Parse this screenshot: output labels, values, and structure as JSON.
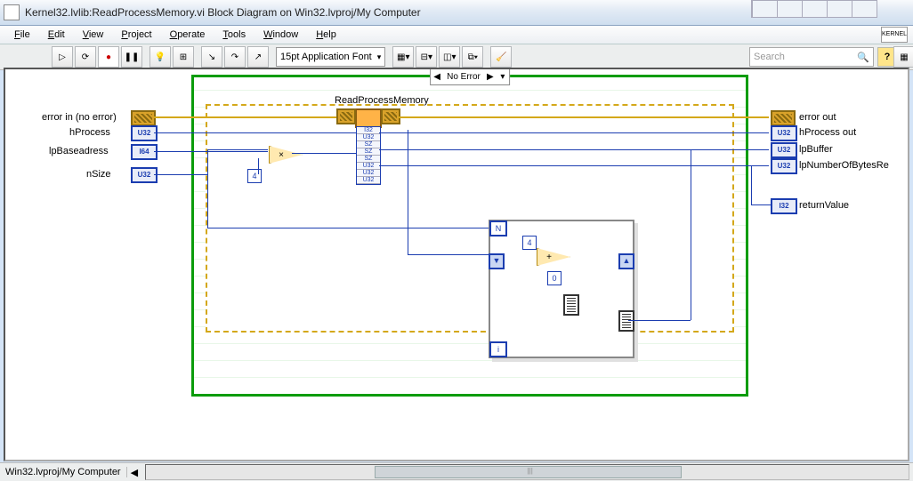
{
  "window": {
    "title": "Kernel32.lvlib:ReadProcessMemory.vi Block Diagram on Win32.lvproj/My Computer"
  },
  "menu": {
    "file": "File",
    "edit": "Edit",
    "view": "View",
    "project": "Project",
    "operate": "Operate",
    "tools": "Tools",
    "window": "Window",
    "help": "Help",
    "logo": "KERNEL"
  },
  "toolbar": {
    "font": "15pt Application Font",
    "search_placeholder": "Search",
    "help": "?"
  },
  "case": {
    "left": "◀",
    "label": "No Error",
    "right": "▶",
    "drop": "▾"
  },
  "inputs": {
    "error_in": "error in (no error)",
    "hProcess": "hProcess",
    "lpBaseaddress": "lpBaseadress",
    "nSize": "nSize"
  },
  "outputs": {
    "error_out": "error out",
    "hProcess_out": "hProcess out",
    "lpBuffer": "lpBuffer",
    "lpNumberOfBytesRe": "lpNumberOfBytesRe",
    "returnValue": "returnValue"
  },
  "types": {
    "u32": "U32",
    "i64": "I64",
    "i32": "I32"
  },
  "node": {
    "name": "ReadProcessMemory",
    "params": [
      "I32",
      "U32",
      "SZ",
      "SZ",
      "SZ",
      "U32",
      "U32",
      "U32"
    ]
  },
  "consts": {
    "four_a": "4",
    "four_b": "4",
    "zero": "0",
    "N": "N",
    "i": "i"
  },
  "shifts": {
    "down": "▼",
    "up": "▲"
  },
  "multiply": "×",
  "add": "+",
  "status": {
    "path": "Win32.lvproj/My Computer",
    "arrow": "◀"
  }
}
